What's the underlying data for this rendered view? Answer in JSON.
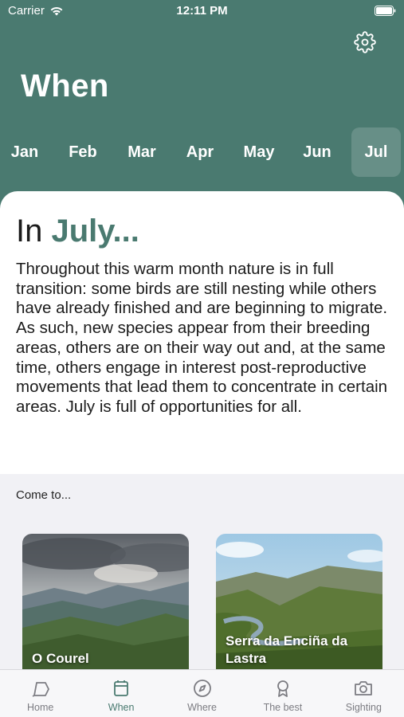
{
  "status_bar": {
    "carrier": "Carrier",
    "time": "12:11 PM"
  },
  "header": {
    "title": "When",
    "settings_icon": "gear-icon"
  },
  "months": [
    "Jan",
    "Feb",
    "Mar",
    "Apr",
    "May",
    "Jun",
    "Jul"
  ],
  "selected_month": "Jul",
  "content": {
    "prefix": "In",
    "month_name": "July...",
    "description": "Throughout this warm month nature is in full transition: some birds are still nesting while others have already finished and are beginning to migrate. As such, new species appear from their breeding areas, others are on their way out and, at the same time, others engage in interest post-reproductive movements that lead them to concentrate in certain areas. July is full of opportunities for all."
  },
  "come_to": {
    "label": "Come to...",
    "places": [
      {
        "name": "O Courel"
      },
      {
        "name": "Serra da Enciña da Lastra"
      }
    ]
  },
  "tab_bar": {
    "tabs": [
      {
        "label": "Home",
        "icon": "home-icon"
      },
      {
        "label": "When",
        "icon": "calendar-icon"
      },
      {
        "label": "Where",
        "icon": "compass-icon"
      },
      {
        "label": "The best",
        "icon": "award-icon"
      },
      {
        "label": "Sighting",
        "icon": "camera-icon"
      }
    ],
    "active": "When"
  },
  "colors": {
    "primary": "#4a7a70",
    "sheet": "#ffffff",
    "section_bg": "#f1f1f5"
  }
}
